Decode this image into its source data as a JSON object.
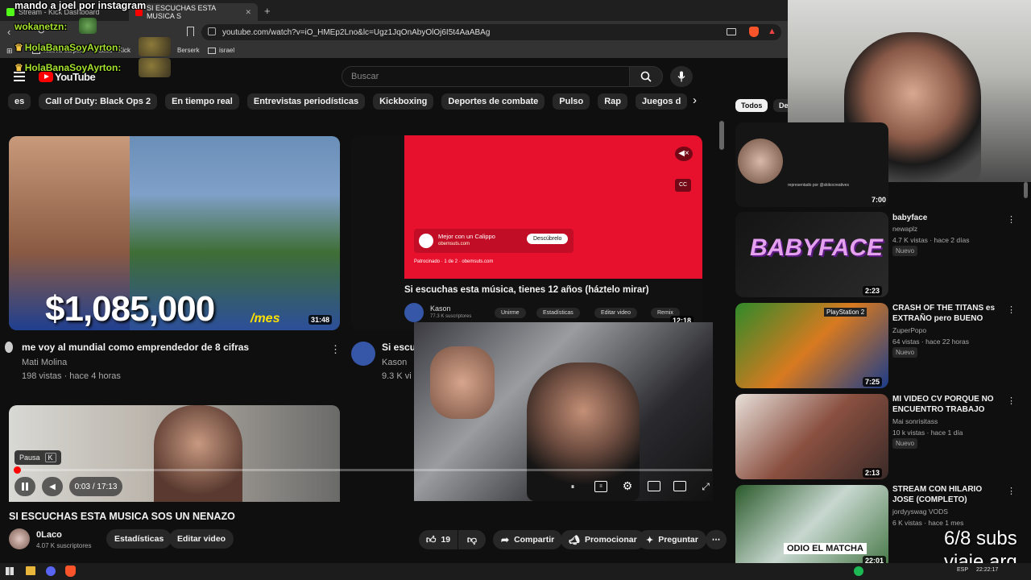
{
  "browser": {
    "tabs": [
      {
        "label": "Stream - Kick Dashboard"
      },
      {
        "label": "SI ESCUCHAS ESTA MUSICA S"
      }
    ],
    "url": "youtube.com/watch?v=iO_HMEp2Lno&lc=Ugz1JqOnAbyOlOj6I5t4AaABAg",
    "bookmarks": [
      "Nueva carpeta",
      "0Laco - Kick",
      "Berserk",
      "israel"
    ]
  },
  "chat": {
    "top_line": "mando a joel por instagram",
    "lines": [
      {
        "name": "wokanetzn:"
      },
      {
        "name": "HolaBanaSoyAyrton:"
      },
      {
        "name": "HolaBanaSoyAyrton:"
      }
    ]
  },
  "youtube": {
    "logo": "YouTube",
    "search_placeholder": "Buscar",
    "chips": [
      "es",
      "Call of Duty: Black Ops 2",
      "En tiempo real",
      "Entrevistas periodísticas",
      "Kickboxing",
      "Deportes de combate",
      "Pulso",
      "Rap",
      "Juegos d"
    ],
    "feed": [
      {
        "title": "me voy al mundial como emprendedor de 8 cifras",
        "channel": "Mati Molina",
        "stats": "198 vistas · hace 4 horas",
        "duration": "31:48",
        "thumb_text": "$1,085,000",
        "thumb_sub": "/mes"
      },
      {
        "title": "Si escu",
        "channel": "Kason",
        "stats": "9.3 K vi"
      }
    ],
    "embedded": {
      "title": "Si escuchas esta música, tienes 12 años (háztelo mirar)",
      "channel": "Kason",
      "subs": "77.3 K suscriptores",
      "buttons": [
        "Unirme",
        "Estadísticas",
        "Editar video",
        "Remix"
      ],
      "ad_title": "Mejor con un Calippo",
      "ad_site": "obemsuts.com",
      "ad_cta": "Descúbrelo",
      "ad_meta": "Patrocinado · 1 de 2 · obemsuts.com",
      "duration": "12:18"
    },
    "player": {
      "tooltip": "Pausa",
      "tooltip_key": "K",
      "time": "0:03 / 17:13",
      "progress": 0.003
    },
    "video": {
      "title": "SI ESCUCHAS ESTA MUSICA SOS UN NENAZO",
      "channel": "0Laco",
      "subs": "4.07 K suscriptores",
      "btn_stats": "Estadísticas",
      "btn_edit": "Editar video",
      "likes": "19",
      "share": "Compartir",
      "promote": "Promocionar",
      "ask": "Preguntar"
    },
    "rail": {
      "filters": [
        "Todos",
        "De"
      ],
      "first_duration": "7:00",
      "first_credit": "representado por @skikocreatives",
      "items": [
        {
          "title": "babyface",
          "channel": "newaplz",
          "stats": "4.7 K vistas · hace 2 días",
          "badge": "Nuevo",
          "duration": "2:23",
          "thumb_text": "BABYFACE"
        },
        {
          "title": "CRASH OF THE TITANS es EXTRAÑO pero BUENO",
          "channel": "ZuperPopo",
          "stats": "64 vistas · hace 22 horas",
          "badge": "Nuevo",
          "duration": "7:25",
          "thumb_text": "PlayStation 2"
        },
        {
          "title": "MI VIDEO CV PORQUE NO ENCUENTRO TRABAJO",
          "channel": "Mai sonrisitass",
          "stats": "10 k vistas · hace 1 día",
          "badge": "Nuevo",
          "duration": "2:13"
        },
        {
          "title": "STREAM CON HILARIO JOSE (COMPLETO)",
          "channel": "jordyyswag VODS",
          "stats": "6 K vistas · hace 1 mes",
          "duration": "22:01",
          "thumb_text": "ODIO EL MATCHA"
        }
      ]
    }
  },
  "overlay": {
    "subs_goal": "6/8 subs",
    "subs_text": "viaje arg"
  },
  "taskbar": {
    "tray_lang": "ESP",
    "clock": "22:22:17"
  },
  "colors": {
    "accent": "#ff0000",
    "bg": "#0f0f0f",
    "chip": "#272727"
  }
}
